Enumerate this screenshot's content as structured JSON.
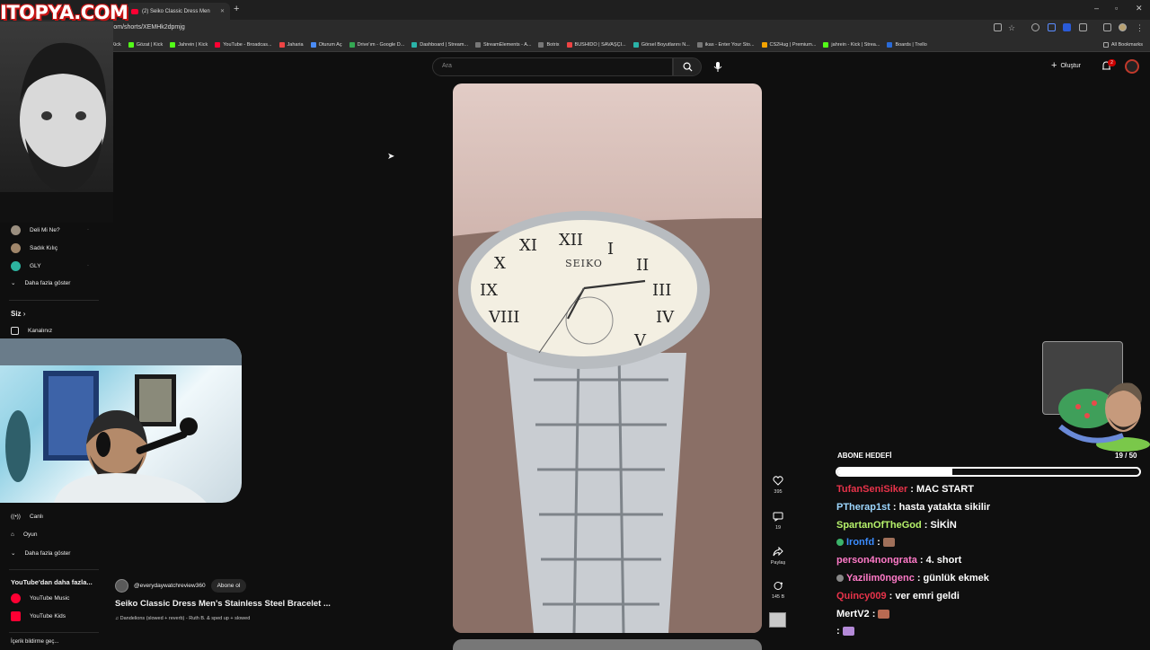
{
  "logo": "ITOPYA.COM",
  "browser": {
    "tab_title": "(2) Seiko Classic Dress Men",
    "url": "youtube.com/shorts/XEMHk2dpmjg",
    "bookmarks": [
      "nci Paneli | Kick",
      "Gözat | Kick",
      "Jahrein | Kick",
      "YouTube - Broadcas...",
      "Jaharia",
      "Oturum Aç",
      "Drive'ım - Google D...",
      "Dashboard | Stream...",
      "StreamElements - A...",
      "Botrix",
      "BUSHIDO | SAVAŞÇI...",
      "Görsel Boyutlarını N...",
      "ikas - Enter Your Sto...",
      "CS2Hug | Premium...",
      "jahrein - Kick | Strea...",
      "Boards | Trello"
    ],
    "all_bookmarks": "All Bookmarks"
  },
  "youtube": {
    "search_placeholder": "Ara",
    "create_label": "Oluştur",
    "notification_count": "2"
  },
  "sidebar": {
    "subs": [
      {
        "label": "Deli Mi Ne?",
        "color": "#9b8f80"
      },
      {
        "label": "Sadık Kılıç",
        "color": "#a0866a"
      },
      {
        "label": "GLY",
        "color": "#2db3a0"
      }
    ],
    "more1": "Daha fazla göster",
    "you_heading": "Siz",
    "your_channel": "Kanalınız",
    "live": "Canlı",
    "gaming": "Oyun",
    "more2": "Daha fazla göster",
    "more_from_yt": "YouTube'dan daha fazla...",
    "yt_music": "YouTube Music",
    "yt_kids": "YouTube Kids",
    "bottom": "İçerik bildirme geç..."
  },
  "short": {
    "channel": "@everydaywatchreview360",
    "subscribe": "Abone ol",
    "title": "Seiko Classic Dress Men's Stainless Steel Bracelet ...",
    "music": "♫ Dandelions (slowed + reverb) - Ruth B. & sped up + slowed",
    "watch_brand": "SEIKO",
    "likes": "395",
    "comments": "19",
    "share": "Paylaş",
    "remix": "145 B"
  },
  "overlay": {
    "goal_label": "ABONE HEDEFİ",
    "goal_count": "19 / 50",
    "goal_progress": 0.38,
    "chat": [
      {
        "user": "TufanSeniSiker",
        "color": "#e8334a",
        "msg": ": MAC START",
        "emote": ""
      },
      {
        "user": "PTherap1st",
        "color": "#9dd7ff",
        "msg": ": hasta yatakta sikilir",
        "emote": ""
      },
      {
        "user": "SpartanOfTheGod",
        "color": "#b6f26b",
        "msg": ": SİKİN",
        "emote": ""
      },
      {
        "user": "Ironfd",
        "color": "#3b8cff",
        "msg": ":",
        "emote": "#a0705a",
        "badge": true
      },
      {
        "user": "person4nongrata",
        "color": "#ff7ac8",
        "msg": ": 4. short",
        "emote": ""
      },
      {
        "user": "Yazilim0ngenc",
        "color": "#ff7ac8",
        "msg": ": günlük ekmek",
        "emote": "",
        "badge": true
      },
      {
        "user": "Quincy009",
        "color": "#e8334a",
        "msg": ": ver emri geldi",
        "emote": ""
      },
      {
        "user": "MertV2",
        "color": "#ffffff",
        "msg": ":",
        "emote": "#b86a52"
      },
      {
        "user": "",
        "color": "#ffffff",
        "msg": ":",
        "emote": "#b48ad8"
      }
    ]
  },
  "colors": {
    "accent": "#ff0033",
    "background": "#0f0f0f"
  }
}
